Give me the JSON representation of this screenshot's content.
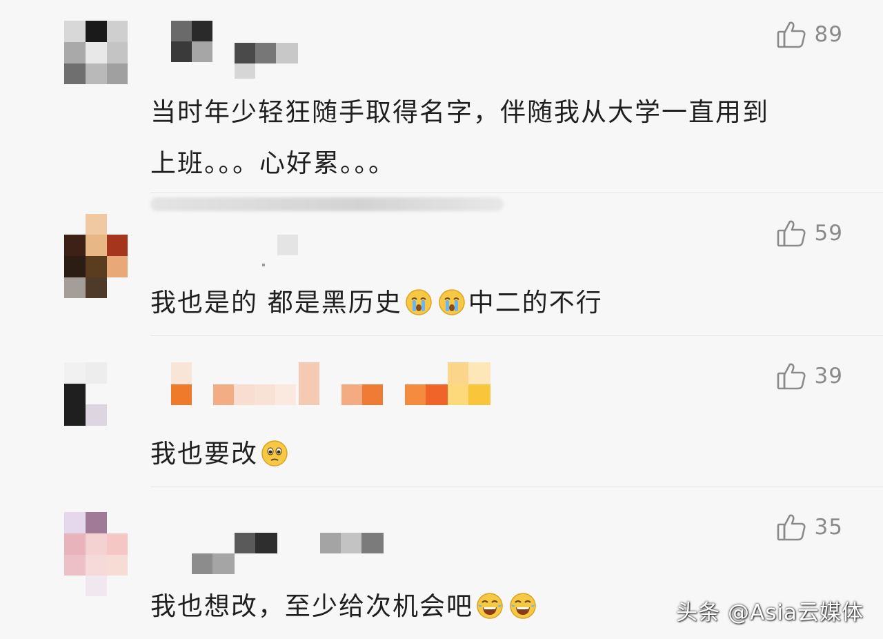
{
  "comments": [
    {
      "likes": "89",
      "text_line1": "当时年少轻狂随手取得名字，伴随我从大学一直用到",
      "text_line2": "上班。。。心好累。。。"
    },
    {
      "likes": "59",
      "text_before": "我也是的  都是黑历史",
      "emoji": "crying-face-emoji",
      "text_after": "中二的不行"
    },
    {
      "likes": "39",
      "text_before": "我也要改",
      "emoji": "pleading-face-emoji"
    },
    {
      "likes": "35",
      "text_before": "我也想改，至少给次机会吧",
      "emoji": "laughing-face-emoji"
    }
  ],
  "watermark": "头条 @Asia云媒体",
  "icons": {
    "like": "thumbs-up-icon"
  },
  "colors": {
    "text": "#1f1f1f",
    "likes": "#8a8a8a",
    "background": "#f7f7f7"
  }
}
